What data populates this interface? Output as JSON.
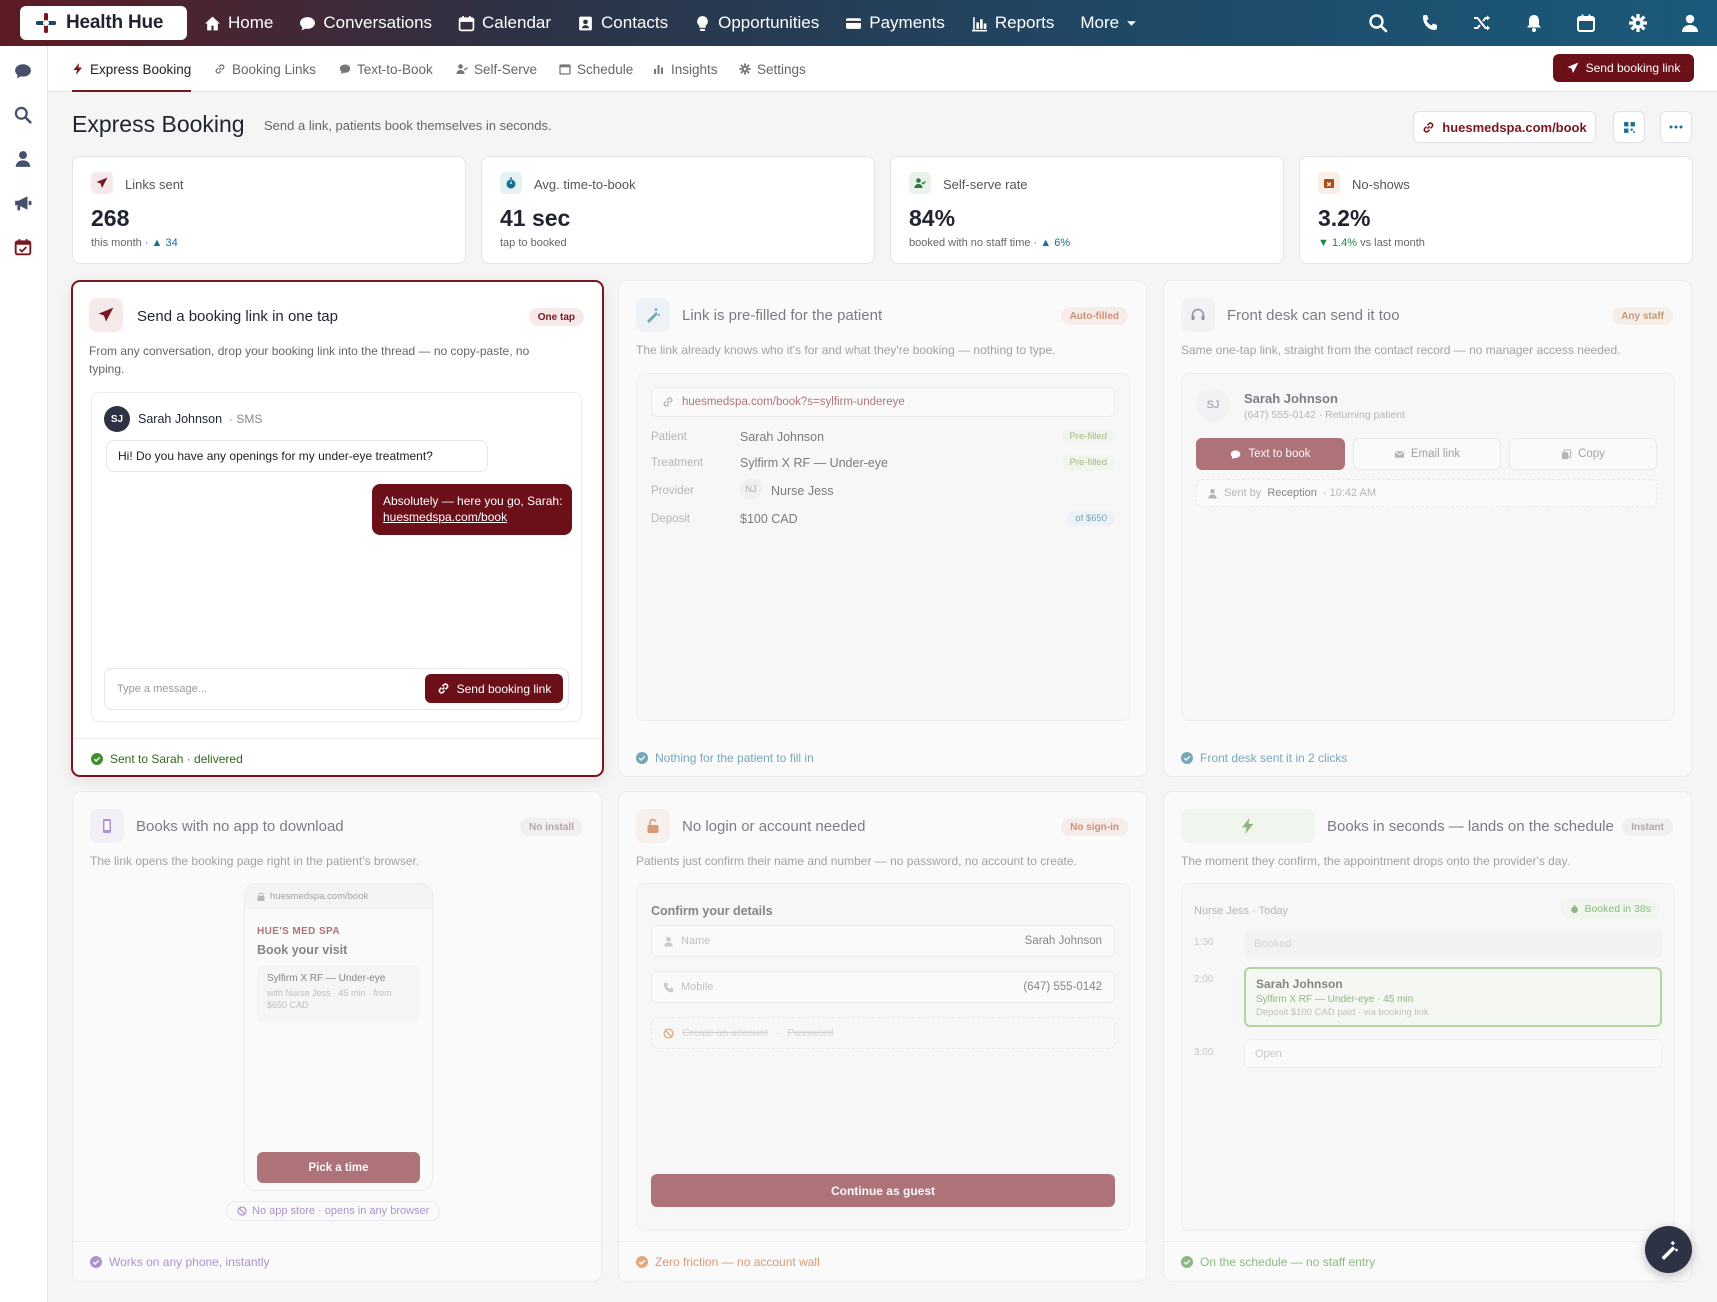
{
  "brand": {
    "name": "Health Hue",
    "accent": "#7a1620"
  },
  "nav": {
    "items": [
      {
        "label": "Home",
        "icon": "home-icon"
      },
      {
        "label": "Conversations",
        "icon": "chat-icon"
      },
      {
        "label": "Calendar",
        "icon": "calendar-icon"
      },
      {
        "label": "Contacts",
        "icon": "contact-card-icon"
      },
      {
        "label": "Opportunities",
        "icon": "lightbulb-icon"
      },
      {
        "label": "Payments",
        "icon": "credit-card-icon"
      },
      {
        "label": "Reports",
        "icon": "bar-chart-icon"
      },
      {
        "label": "More",
        "icon": "chevron-down-icon"
      }
    ]
  },
  "subnav": {
    "tabs": [
      "Express Booking",
      "Booking Links",
      "Text-to-Book",
      "Self-Serve",
      "Schedule",
      "Insights",
      "Settings"
    ],
    "active": "Express Booking",
    "cta": "Send booking link"
  },
  "header": {
    "title": "Express Booking",
    "subtitle": "Send a link, patients book themselves in seconds.",
    "url": "huesmedspa.com/book"
  },
  "kpis": [
    {
      "label": "Links sent",
      "value": "268",
      "sub": "this month ·",
      "delta": "▲ 34",
      "color": "#7a1620"
    },
    {
      "label": "Avg. time-to-book",
      "value": "41 sec",
      "sub": "tap to booked",
      "delta": "",
      "color": "#1a6f90"
    },
    {
      "label": "Self-serve rate",
      "value": "84%",
      "sub": "booked with no staff time ·",
      "delta": "▲ 6%",
      "color": "#2f7a40"
    },
    {
      "label": "No-shows",
      "value": "3.2%",
      "sub": "vs last month",
      "delta": "▼ 1.4%",
      "color": "#b04a1a"
    }
  ],
  "cards": {
    "c1": {
      "title": "Send a booking link in one tap",
      "badge": "One tap",
      "desc": "From any conversation, drop your booking link into the thread — no copy-paste, no typing.",
      "contact_initials": "SJ",
      "contact": "Sarah Johnson",
      "channel": "· SMS",
      "msg_in": "Hi! Do you have any openings for my under-eye treatment?",
      "msg_out": "Absolutely — here you go, Sarah:",
      "msg_link": "huesmedspa.com/book",
      "placeholder": "Type a message...",
      "send": "Send booking link",
      "foot": "Sent to Sarah · delivered"
    },
    "c2": {
      "title": "Link is pre-filled for the patient",
      "badge": "Auto-filled",
      "desc": "The link already knows who it's for and what they're booking — nothing to type.",
      "url": "huesmedspa.com/book?s=sylfirm-undereye",
      "rows": [
        {
          "label": "Patient",
          "value": "Sarah Johnson",
          "tag": "Pre-filled"
        },
        {
          "label": "Treatment",
          "value": "Sylfirm X RF — Under-eye",
          "tag": "Pre-filled"
        },
        {
          "label": "Provider",
          "value": "Nurse Jess",
          "tag": ""
        },
        {
          "label": "Deposit",
          "value": "$100 CAD",
          "tag": "of $650"
        }
      ],
      "provider_initials": "NJ",
      "foot": "Nothing for the patient to fill in"
    },
    "c3": {
      "title": "Front desk can send it too",
      "badge": "Any staff",
      "desc": "Same one-tap link, straight from the contact record — no manager access needed.",
      "initials": "SJ",
      "name": "Sarah Johnson",
      "meta": "(647) 555-0142 · Returning patient",
      "btn1": "Text to book",
      "btn2": "Email link",
      "btn3": "Copy",
      "sent_by": "Sent by",
      "sent_who": "Reception",
      "sent_time": "· 10:42 AM",
      "foot": "Front desk sent it in 2 clicks"
    },
    "c4": {
      "title": "Books with no app to download",
      "badge": "No install",
      "desc": "The link opens the booking page right in the patient's browser.",
      "url": "huesmedspa.com/book",
      "spa": "HUE'S MED SPA",
      "heading": "Book your visit",
      "treatment": "Sylfirm X RF — Under-eye",
      "treatment_meta": "with Nurse Jess · 45 min · from $650 CAD",
      "cta": "Pick a time",
      "note": "No app store · opens in any browser",
      "foot": "Works on any phone, instantly"
    },
    "c5": {
      "title": "No login or account needed",
      "badge": "No sign-in",
      "desc": "Patients just confirm their name and number — no password, no account to create.",
      "form_title": "Confirm your details",
      "name_label": "Name",
      "name_value": "Sarah Johnson",
      "mobile_label": "Mobile",
      "mobile_value": "(647) 555-0142",
      "create": "Create an account",
      "password": "Password",
      "cta": "Continue as guest",
      "foot": "Zero friction — no account wall"
    },
    "c6": {
      "title": "Books in seconds — lands on the schedule",
      "badge": "Instant",
      "desc": "The moment they confirm, the appointment drops onto the provider's day.",
      "cal_header": "Nurse Jess · Today",
      "booked_badge": "Booked in 38s",
      "slots": [
        {
          "time": "1:30",
          "text": "Booked"
        },
        {
          "time": "2:00",
          "text": ""
        },
        {
          "time": "3:00",
          "text": "Open"
        }
      ],
      "appt_name": "Sarah Johnson",
      "appt_detail": "Sylfirm X RF — Under-eye · 45 min",
      "appt_meta": "Deposit $100 CAD paid · via booking link",
      "foot": "On the schedule — no staff entry"
    }
  }
}
